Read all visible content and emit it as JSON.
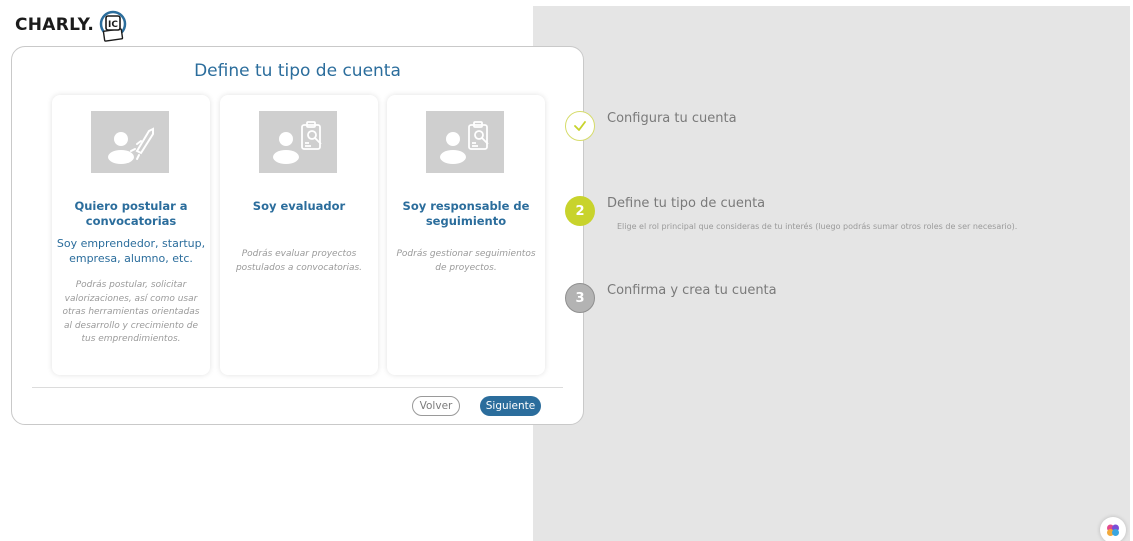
{
  "brand": {
    "logo_text": "CHARLY.",
    "badge_glyph": "IC"
  },
  "modal": {
    "title": "Define tu tipo de cuenta",
    "cards": [
      {
        "title": "Quiero postular a convocatorias",
        "subtitle": "Soy emprendedor, startup, empresa, alumno, etc.",
        "description": "Podrás postular, solicitar valorizaciones, así como usar otras herramientas orientadas al desarrollo y crecimiento de tus emprendimientos.",
        "icon": "person-rocket-icon"
      },
      {
        "title": "Soy evaluador",
        "subtitle": "",
        "description": "Podrás evaluar proyectos postulados a convocatorias.",
        "icon": "person-clipboard-icon"
      },
      {
        "title": "Soy responsable de seguimiento",
        "subtitle": "",
        "description": "Podrás gestionar seguimientos de proyectos.",
        "icon": "person-clipboard-icon"
      }
    ],
    "back_label": "Volver",
    "next_label": "Siguiente"
  },
  "steps": [
    {
      "number": "",
      "title": "Configura tu cuenta",
      "description": "",
      "state": "done"
    },
    {
      "number": "2",
      "title": "Define tu tipo de cuenta",
      "description": "Elige el rol principal que consideras de tu interés (luego podrás sumar otros roles de ser necesario).",
      "state": "active"
    },
    {
      "number": "3",
      "title": "Confirma y crea tu cuenta",
      "description": "",
      "state": "pending"
    }
  ],
  "colors": {
    "accent": "#2b6d9c",
    "step_active": "#c8d32c",
    "step_pending": "#b3b3b3",
    "panel_bg": "#e5e5e5"
  }
}
